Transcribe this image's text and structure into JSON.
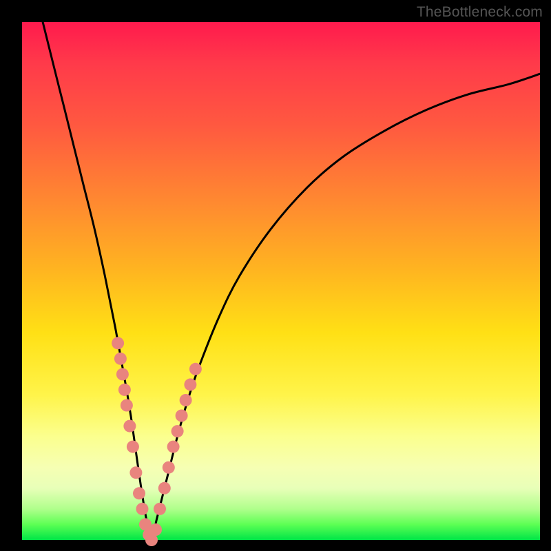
{
  "watermark": "TheBottleneck.com",
  "chart_data": {
    "type": "line",
    "title": "",
    "xlabel": "",
    "ylabel": "",
    "xlim": [
      0,
      100
    ],
    "ylim": [
      0,
      100
    ],
    "grid": false,
    "series": [
      {
        "name": "bottleneck-curve",
        "color": "#000000",
        "x": [
          4,
          6,
          8,
          10,
          12,
          14,
          16,
          18,
          20,
          21,
          22,
          23,
          24,
          25,
          26,
          28,
          30,
          32,
          34,
          38,
          42,
          48,
          55,
          62,
          70,
          78,
          86,
          94,
          100
        ],
        "y": [
          100,
          92,
          84,
          76,
          68,
          60,
          51,
          41,
          30,
          24,
          17,
          10,
          4,
          0,
          4,
          12,
          20,
          27,
          33,
          43,
          51,
          60,
          68,
          74,
          79,
          83,
          86,
          88,
          90
        ]
      }
    ],
    "markers": [
      {
        "name": "cluster-left",
        "color": "#e9847e",
        "points": [
          {
            "x": 18.5,
            "y": 38
          },
          {
            "x": 19.0,
            "y": 35
          },
          {
            "x": 19.4,
            "y": 32
          },
          {
            "x": 19.8,
            "y": 29
          },
          {
            "x": 20.2,
            "y": 26
          },
          {
            "x": 20.8,
            "y": 22
          },
          {
            "x": 21.4,
            "y": 18
          },
          {
            "x": 22.0,
            "y": 13
          },
          {
            "x": 22.6,
            "y": 9
          },
          {
            "x": 23.2,
            "y": 6
          },
          {
            "x": 23.8,
            "y": 3
          },
          {
            "x": 24.5,
            "y": 1
          }
        ]
      },
      {
        "name": "cluster-bottom",
        "color": "#e9847e",
        "points": [
          {
            "x": 25.0,
            "y": 0
          },
          {
            "x": 25.8,
            "y": 2
          },
          {
            "x": 26.6,
            "y": 6
          }
        ]
      },
      {
        "name": "cluster-right",
        "color": "#e9847e",
        "points": [
          {
            "x": 27.5,
            "y": 10
          },
          {
            "x": 28.3,
            "y": 14
          },
          {
            "x": 29.2,
            "y": 18
          },
          {
            "x": 30.0,
            "y": 21
          },
          {
            "x": 30.8,
            "y": 24
          },
          {
            "x": 31.6,
            "y": 27
          },
          {
            "x": 32.5,
            "y": 30
          },
          {
            "x": 33.5,
            "y": 33
          }
        ]
      }
    ]
  },
  "colors": {
    "frame": "#000000",
    "watermark": "#555555",
    "curve": "#000000",
    "marker": "#e9847e"
  }
}
